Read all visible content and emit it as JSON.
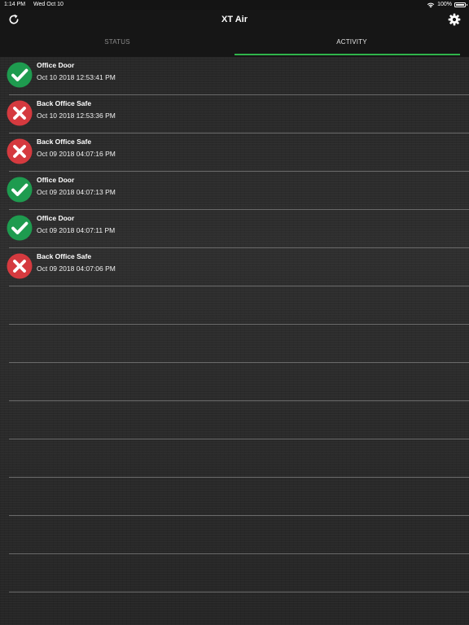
{
  "status_bar": {
    "time": "1:14 PM",
    "date": "Wed Oct 10",
    "battery": "100%"
  },
  "header": {
    "title": "XT Air",
    "refresh_icon": "refresh-icon",
    "settings_icon": "gear-icon"
  },
  "tabs": [
    {
      "label": "STATUS",
      "active": false
    },
    {
      "label": "ACTIVITY",
      "active": true
    }
  ],
  "colors": {
    "accent": "#2fb44a",
    "success": "#1e9b4f",
    "failure": "#d53a3f"
  },
  "activity": [
    {
      "title": "Office Door",
      "time": "Oct 10 2018 12:53:41 PM",
      "status": "success"
    },
    {
      "title": "Back Office Safe",
      "time": "Oct 10 2018 12:53:36 PM",
      "status": "failure"
    },
    {
      "title": "Back Office Safe",
      "time": "Oct 09 2018 04:07:16 PM",
      "status": "failure"
    },
    {
      "title": "Office Door",
      "time": "Oct 09 2018 04:07:13 PM",
      "status": "success"
    },
    {
      "title": "Office Door",
      "time": "Oct 09 2018 04:07:11 PM",
      "status": "success"
    },
    {
      "title": "Back Office Safe",
      "time": "Oct 09 2018 04:07:06 PM",
      "status": "failure"
    }
  ]
}
